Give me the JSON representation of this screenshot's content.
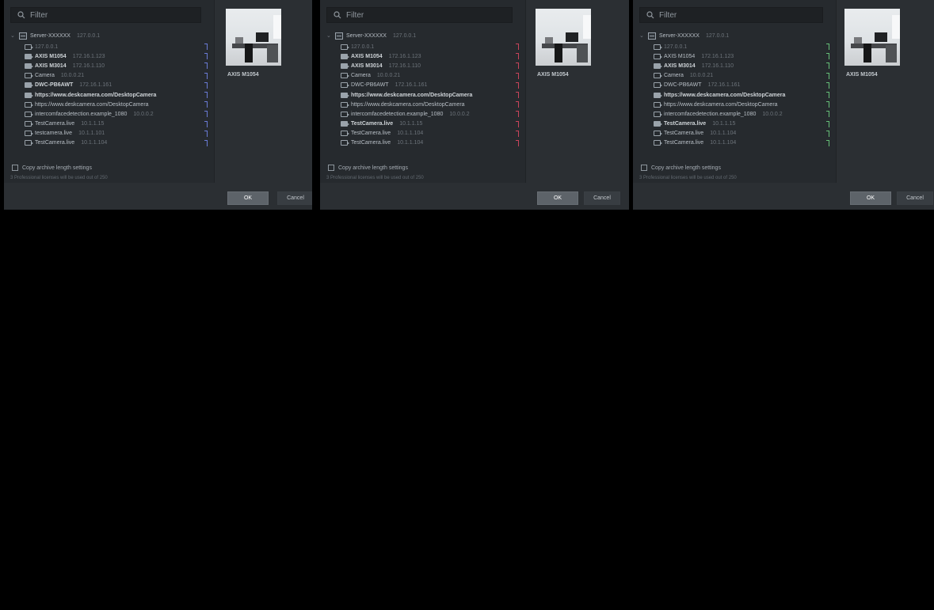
{
  "colors": {
    "background": "#000000",
    "dialog_background": "#2b2f33",
    "tree_background": "#262a2e",
    "marker_blue": "#6a7bd6",
    "marker_red": "#c8445b",
    "marker_green": "#65bf78"
  },
  "dialogs": [
    {
      "filter": {
        "placeholder": "Filter",
        "icon": "search-icon"
      },
      "server": {
        "name": "Server-XXXXXX",
        "address": "127.0.0.1"
      },
      "cameras": [
        {
          "name": "127.0.0.1",
          "address": "",
          "style": "faint",
          "marker": "blue"
        },
        {
          "name": "AXIS M1054",
          "address": "172.16.1.123",
          "style": "strong",
          "marker": "blue"
        },
        {
          "name": "AXIS M3014",
          "address": "172.16.1.110",
          "style": "strong",
          "marker": "blue"
        },
        {
          "name": "Camera",
          "address": "10.0.0.21",
          "style": "normal",
          "marker": "blue"
        },
        {
          "name": "DWC-PB6AWT",
          "address": "172.16.1.161",
          "style": "strong",
          "marker": "blue"
        },
        {
          "name": "https://www.deskcamera.com/DesktopCamera",
          "address": "",
          "style": "strong",
          "marker": "blue"
        },
        {
          "name": "https://www.deskcamera.com/DesktopCamera",
          "address": "",
          "style": "normal",
          "marker": "blue"
        },
        {
          "name": "intercomfacedetection.example_1080",
          "address": "10.0.0.2",
          "style": "normal",
          "marker": "blue"
        },
        {
          "name": "TestCamera.live",
          "address": "10.1.1.15",
          "style": "normal",
          "marker": "blue"
        },
        {
          "name": "testcamera.live",
          "address": "10.1.1.101",
          "style": "normal",
          "marker": "blue"
        },
        {
          "name": "TestCamera.live",
          "address": "10.1.1.104",
          "style": "normal",
          "marker": "blue"
        }
      ],
      "copy_checkbox_label": "Copy archive length settings",
      "hint": "3 Professional licenses will be used out of 250",
      "preview_label": "AXIS M1054",
      "ok_label": "OK",
      "cancel_label": "Cancel"
    },
    {
      "filter": {
        "placeholder": "Filter",
        "icon": "search-icon"
      },
      "server": {
        "name": "Server-XXXXXX",
        "address": "127.0.0.1"
      },
      "cameras": [
        {
          "name": "127.0.0.1",
          "address": "",
          "style": "faint",
          "marker": "red"
        },
        {
          "name": "AXIS M1054",
          "address": "172.16.1.123",
          "style": "strong",
          "marker": "red"
        },
        {
          "name": "AXIS M3014",
          "address": "172.16.1.110",
          "style": "strong",
          "marker": "red"
        },
        {
          "name": "Camera",
          "address": "10.0.0.21",
          "style": "normal",
          "marker": "red"
        },
        {
          "name": "DWC-PB6AWT",
          "address": "172.16.1.161",
          "style": "normal",
          "marker": "red"
        },
        {
          "name": "https://www.deskcamera.com/DesktopCamera",
          "address": "",
          "style": "strong",
          "marker": "red"
        },
        {
          "name": "https://www.deskcamera.com/DesktopCamera",
          "address": "",
          "style": "normal",
          "marker": "red"
        },
        {
          "name": "intercomfacedetection.example_1080",
          "address": "10.0.0.2",
          "style": "normal",
          "marker": "red"
        },
        {
          "name": "TestCamera.live",
          "address": "10.1.1.15",
          "style": "strong",
          "marker": "red"
        },
        {
          "name": "TestCamera.live",
          "address": "10.1.1.104",
          "style": "normal",
          "marker": "red"
        },
        {
          "name": "TestCamera.live",
          "address": "10.1.1.104",
          "style": "normal",
          "marker": "red"
        }
      ],
      "copy_checkbox_label": "Copy archive length settings",
      "hint": "3 Professional licenses will be used out of 250",
      "preview_label": "AXIS M1054",
      "ok_label": "OK",
      "cancel_label": "Cancel"
    },
    {
      "filter": {
        "placeholder": "Filter",
        "icon": "search-icon"
      },
      "server": {
        "name": "Server-XXXXXX",
        "address": "127.0.0.1"
      },
      "cameras": [
        {
          "name": "127.0.0.1",
          "address": "",
          "style": "faint",
          "marker": "green"
        },
        {
          "name": "AXIS M1054",
          "address": "172.16.1.123",
          "style": "normal",
          "marker": "green"
        },
        {
          "name": "AXIS M3014",
          "address": "172.16.1.110",
          "style": "strong",
          "marker": "green"
        },
        {
          "name": "Camera",
          "address": "10.0.0.21",
          "style": "normal",
          "marker": "green"
        },
        {
          "name": "DWC-PB6AWT",
          "address": "172.16.1.161",
          "style": "normal",
          "marker": "green"
        },
        {
          "name": "https://www.deskcamera.com/DesktopCamera",
          "address": "",
          "style": "strong",
          "marker": "green"
        },
        {
          "name": "https://www.deskcamera.com/DesktopCamera",
          "address": "",
          "style": "normal",
          "marker": "green"
        },
        {
          "name": "intercomfacedetection.example_1080",
          "address": "10.0.0.2",
          "style": "normal",
          "marker": "green"
        },
        {
          "name": "TestCamera.live",
          "address": "10.1.1.15",
          "style": "strong",
          "marker": "green"
        },
        {
          "name": "TestCamera.live",
          "address": "10.1.1.104",
          "style": "normal",
          "marker": "green"
        },
        {
          "name": "TestCamera.live",
          "address": "10.1.1.104",
          "style": "normal",
          "marker": "green"
        }
      ],
      "copy_checkbox_label": "Copy archive length settings",
      "hint": "3 Professional licenses will be used out of 250",
      "preview_label": "AXIS M1054",
      "ok_label": "OK",
      "cancel_label": "Cancel"
    }
  ]
}
